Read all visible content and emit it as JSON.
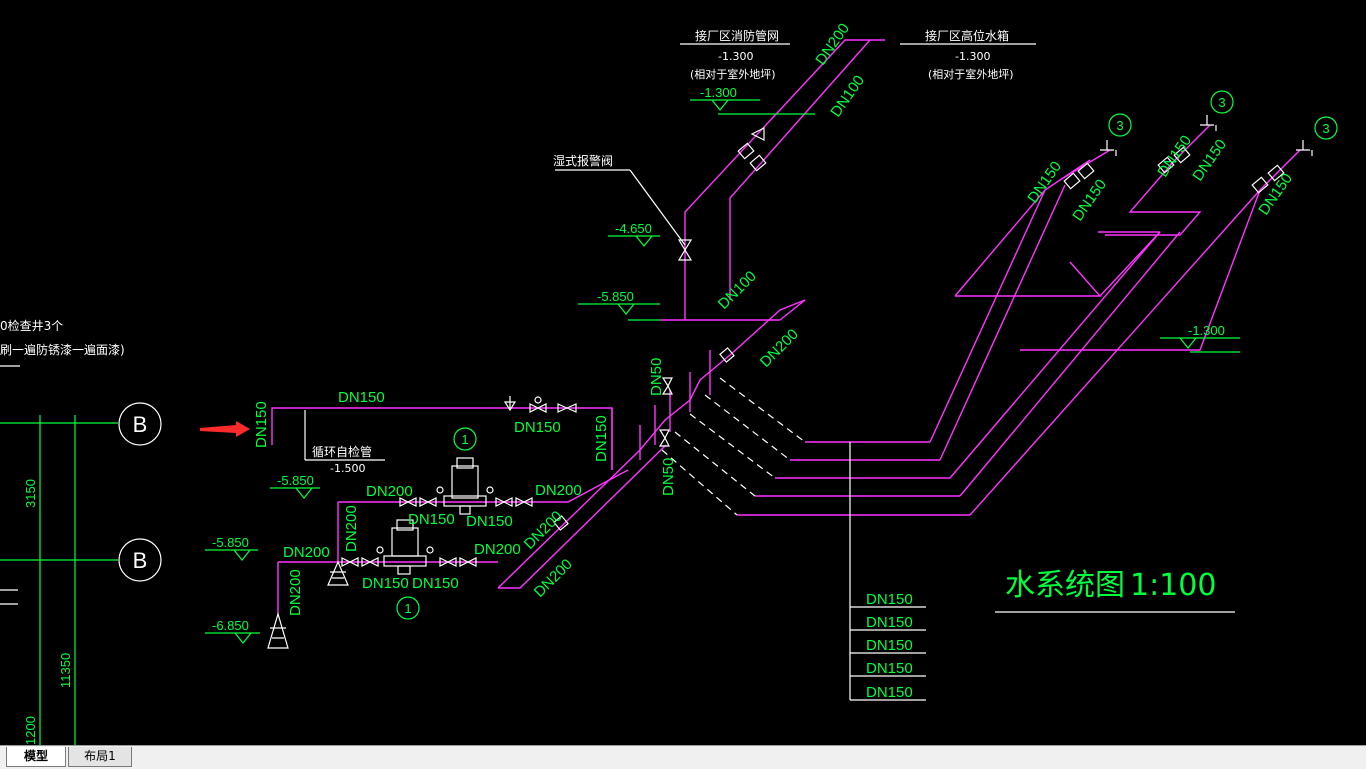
{
  "labels": {
    "left_note_1": "0检查井3个",
    "left_note_2": "刷一遍防锈漆一遍面漆)",
    "dim_3150": "3150",
    "dim_11350": "11350",
    "dim_1200": "1200",
    "grid_b": "B",
    "top_label_1": "接厂区消防管网",
    "top_label_1_elev": "-1.300",
    "top_label_1_note": "(相对于室外地坪)",
    "top_label_2": "接厂区高位水箱",
    "top_label_2_elev": "-1.300",
    "top_label_2_note": "(相对于室外地坪)",
    "elev_1300_a": "-1.300",
    "alarm_valve": "湿式报警阀",
    "elev_4650": "-4.650",
    "elev_5850_a": "-5.850",
    "elev_5850_b": "-5.850",
    "elev_5850_c": "-5.850",
    "elev_6850": "-6.850",
    "elev_1300_b": "-1.300",
    "elev_1500": "-1.500",
    "recirc_pipe": "循环自检管",
    "pump_tag": "1",
    "branch_tag": "3"
  },
  "pipe_sizes": {
    "dn200": "DN200",
    "dn150": "DN150",
    "dn100": "DN100",
    "dn50": "DN50"
  },
  "outlet_table": [
    "DN150",
    "DN150",
    "DN150",
    "DN150",
    "DN150"
  ],
  "title": {
    "name": "水系统图",
    "scale": "1:100"
  },
  "tabs": [
    {
      "label": "模型",
      "active": true
    },
    {
      "label": "布局1",
      "active": false
    }
  ],
  "colors": {
    "background": "#000000",
    "pipe": "#ff33ff",
    "annotation": "#00ff3c",
    "linework": "#ffffff",
    "arrow": "#ff2a2a"
  }
}
